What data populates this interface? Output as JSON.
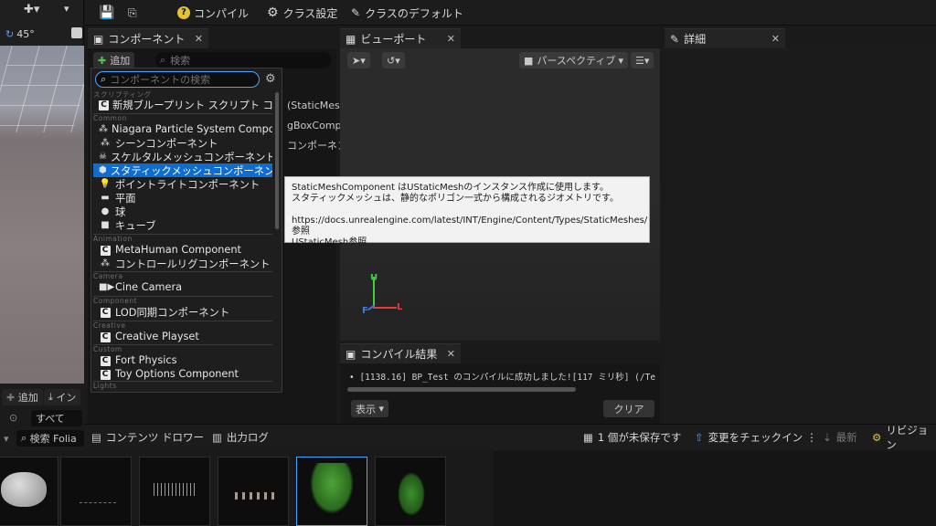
{
  "toolbar": {
    "compile": "コンパイル",
    "class_settings": "クラス設定",
    "class_defaults": "クラスのデフォルト"
  },
  "left_strip": {
    "angle": "45°"
  },
  "components": {
    "tab": "コンポーネント",
    "add": "追加",
    "search_placeholder": "検索",
    "dropdown_search_placeholder": "コンポーネントの検索",
    "behind_lines": [
      "(StaticMes",
      "gBoxCompo",
      "コンポーネン"
    ],
    "categories": {
      "scripting": "スクリプティング",
      "common": "Common",
      "animation": "Animation",
      "camera": "Camera",
      "component": "Component",
      "creative": "Creative",
      "custom": "Custom",
      "lights": "Lights"
    },
    "items": {
      "new_bp": "新規ブループリント スクリプト コンポ",
      "niagara": "Niagara Particle System Component",
      "scene": "シーンコンポーネント",
      "skeletal": "スケルタルメッシュコンポーネント",
      "static": "スタティックメッシュコンポーネント",
      "point": "ポイントライトコンポーネント",
      "plane": "平面",
      "sphere": "球",
      "cube": "キューブ",
      "metahuman": "MetaHuman Component",
      "controlrig": "コントロールリグコンポーネント",
      "cine": "Cine Camera",
      "lod": "LOD同期コンポーネント",
      "creative": "Creative Playset",
      "fort": "Fort Physics",
      "toy": "Toy Options Component"
    }
  },
  "tooltip": {
    "line1": "StaticMeshComponent はUStaticMeshのインスタンス作成に使用します。",
    "line2": "スタティックメッシュは、静的なポリゴン一式から構成されるジオメトリです。",
    "line3": "https://docs.unrealengine.com/latest/INT/Engine/Content/Types/StaticMeshes/参照",
    "line4": "UStaticMesh参照"
  },
  "viewport": {
    "tab": "ビューポート",
    "perspective": "パースペクティブ",
    "axis_u": "U",
    "axis_f": "F",
    "axis_l": "L"
  },
  "details": {
    "tab": "詳細"
  },
  "compile_results": {
    "tab": "コンパイル結果",
    "message": "[1138.16] BP_Test のコンパイルに成功しました![117 ミリ秒] (/Te",
    "show": "表示",
    "clear": "クリア"
  },
  "left_bottom": {
    "add": "追加",
    "import": "イン",
    "all": "すべて",
    "search": "検索 Folia"
  },
  "bottom_bar": {
    "content_drawer": "コンテンツ ドロワー",
    "output_log": "出力ログ",
    "unsaved": "1 個が未保存です",
    "check_in": "変更をチェックイン",
    "latest": "最新",
    "revision": "リビジョン"
  },
  "colors": {
    "accent": "#0f6dd0",
    "yellow": "#e3c23a",
    "axis_green": "#3fcf3f",
    "axis_red": "#e23b3b",
    "axis_blue": "#3c78e8"
  }
}
